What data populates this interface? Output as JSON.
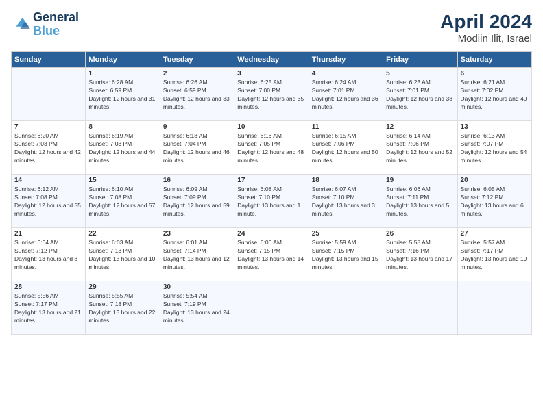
{
  "logo": {
    "line1": "General",
    "line2": "Blue"
  },
  "title": "April 2024",
  "location": "Modiin Ilit, Israel",
  "headers": [
    "Sunday",
    "Monday",
    "Tuesday",
    "Wednesday",
    "Thursday",
    "Friday",
    "Saturday"
  ],
  "weeks": [
    [
      {
        "day": "",
        "sunrise": "",
        "sunset": "",
        "daylight": ""
      },
      {
        "day": "1",
        "sunrise": "Sunrise: 6:28 AM",
        "sunset": "Sunset: 6:59 PM",
        "daylight": "Daylight: 12 hours and 31 minutes."
      },
      {
        "day": "2",
        "sunrise": "Sunrise: 6:26 AM",
        "sunset": "Sunset: 6:59 PM",
        "daylight": "Daylight: 12 hours and 33 minutes."
      },
      {
        "day": "3",
        "sunrise": "Sunrise: 6:25 AM",
        "sunset": "Sunset: 7:00 PM",
        "daylight": "Daylight: 12 hours and 35 minutes."
      },
      {
        "day": "4",
        "sunrise": "Sunrise: 6:24 AM",
        "sunset": "Sunset: 7:01 PM",
        "daylight": "Daylight: 12 hours and 36 minutes."
      },
      {
        "day": "5",
        "sunrise": "Sunrise: 6:23 AM",
        "sunset": "Sunset: 7:01 PM",
        "daylight": "Daylight: 12 hours and 38 minutes."
      },
      {
        "day": "6",
        "sunrise": "Sunrise: 6:21 AM",
        "sunset": "Sunset: 7:02 PM",
        "daylight": "Daylight: 12 hours and 40 minutes."
      }
    ],
    [
      {
        "day": "7",
        "sunrise": "Sunrise: 6:20 AM",
        "sunset": "Sunset: 7:03 PM",
        "daylight": "Daylight: 12 hours and 42 minutes."
      },
      {
        "day": "8",
        "sunrise": "Sunrise: 6:19 AM",
        "sunset": "Sunset: 7:03 PM",
        "daylight": "Daylight: 12 hours and 44 minutes."
      },
      {
        "day": "9",
        "sunrise": "Sunrise: 6:18 AM",
        "sunset": "Sunset: 7:04 PM",
        "daylight": "Daylight: 12 hours and 46 minutes."
      },
      {
        "day": "10",
        "sunrise": "Sunrise: 6:16 AM",
        "sunset": "Sunset: 7:05 PM",
        "daylight": "Daylight: 12 hours and 48 minutes."
      },
      {
        "day": "11",
        "sunrise": "Sunrise: 6:15 AM",
        "sunset": "Sunset: 7:06 PM",
        "daylight": "Daylight: 12 hours and 50 minutes."
      },
      {
        "day": "12",
        "sunrise": "Sunrise: 6:14 AM",
        "sunset": "Sunset: 7:06 PM",
        "daylight": "Daylight: 12 hours and 52 minutes."
      },
      {
        "day": "13",
        "sunrise": "Sunrise: 6:13 AM",
        "sunset": "Sunset: 7:07 PM",
        "daylight": "Daylight: 12 hours and 54 minutes."
      }
    ],
    [
      {
        "day": "14",
        "sunrise": "Sunrise: 6:12 AM",
        "sunset": "Sunset: 7:08 PM",
        "daylight": "Daylight: 12 hours and 55 minutes."
      },
      {
        "day": "15",
        "sunrise": "Sunrise: 6:10 AM",
        "sunset": "Sunset: 7:08 PM",
        "daylight": "Daylight: 12 hours and 57 minutes."
      },
      {
        "day": "16",
        "sunrise": "Sunrise: 6:09 AM",
        "sunset": "Sunset: 7:09 PM",
        "daylight": "Daylight: 12 hours and 59 minutes."
      },
      {
        "day": "17",
        "sunrise": "Sunrise: 6:08 AM",
        "sunset": "Sunset: 7:10 PM",
        "daylight": "Daylight: 13 hours and 1 minute."
      },
      {
        "day": "18",
        "sunrise": "Sunrise: 6:07 AM",
        "sunset": "Sunset: 7:10 PM",
        "daylight": "Daylight: 13 hours and 3 minutes."
      },
      {
        "day": "19",
        "sunrise": "Sunrise: 6:06 AM",
        "sunset": "Sunset: 7:11 PM",
        "daylight": "Daylight: 13 hours and 5 minutes."
      },
      {
        "day": "20",
        "sunrise": "Sunrise: 6:05 AM",
        "sunset": "Sunset: 7:12 PM",
        "daylight": "Daylight: 13 hours and 6 minutes."
      }
    ],
    [
      {
        "day": "21",
        "sunrise": "Sunrise: 6:04 AM",
        "sunset": "Sunset: 7:12 PM",
        "daylight": "Daylight: 13 hours and 8 minutes."
      },
      {
        "day": "22",
        "sunrise": "Sunrise: 6:03 AM",
        "sunset": "Sunset: 7:13 PM",
        "daylight": "Daylight: 13 hours and 10 minutes."
      },
      {
        "day": "23",
        "sunrise": "Sunrise: 6:01 AM",
        "sunset": "Sunset: 7:14 PM",
        "daylight": "Daylight: 13 hours and 12 minutes."
      },
      {
        "day": "24",
        "sunrise": "Sunrise: 6:00 AM",
        "sunset": "Sunset: 7:15 PM",
        "daylight": "Daylight: 13 hours and 14 minutes."
      },
      {
        "day": "25",
        "sunrise": "Sunrise: 5:59 AM",
        "sunset": "Sunset: 7:15 PM",
        "daylight": "Daylight: 13 hours and 15 minutes."
      },
      {
        "day": "26",
        "sunrise": "Sunrise: 5:58 AM",
        "sunset": "Sunset: 7:16 PM",
        "daylight": "Daylight: 13 hours and 17 minutes."
      },
      {
        "day": "27",
        "sunrise": "Sunrise: 5:57 AM",
        "sunset": "Sunset: 7:17 PM",
        "daylight": "Daylight: 13 hours and 19 minutes."
      }
    ],
    [
      {
        "day": "28",
        "sunrise": "Sunrise: 5:56 AM",
        "sunset": "Sunset: 7:17 PM",
        "daylight": "Daylight: 13 hours and 21 minutes."
      },
      {
        "day": "29",
        "sunrise": "Sunrise: 5:55 AM",
        "sunset": "Sunset: 7:18 PM",
        "daylight": "Daylight: 13 hours and 22 minutes."
      },
      {
        "day": "30",
        "sunrise": "Sunrise: 5:54 AM",
        "sunset": "Sunset: 7:19 PM",
        "daylight": "Daylight: 13 hours and 24 minutes."
      },
      {
        "day": "",
        "sunrise": "",
        "sunset": "",
        "daylight": ""
      },
      {
        "day": "",
        "sunrise": "",
        "sunset": "",
        "daylight": ""
      },
      {
        "day": "",
        "sunrise": "",
        "sunset": "",
        "daylight": ""
      },
      {
        "day": "",
        "sunrise": "",
        "sunset": "",
        "daylight": ""
      }
    ]
  ]
}
